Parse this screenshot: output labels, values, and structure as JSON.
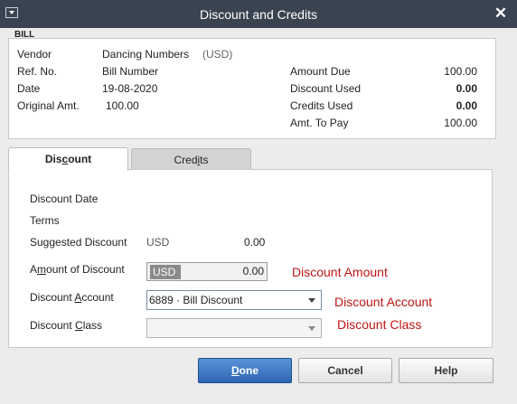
{
  "window": {
    "title": "Discount and Credits",
    "close_glyph": "✕"
  },
  "bill": {
    "section_label": "BILL",
    "vendor_label": "Vendor",
    "vendor_value": "Dancing Numbers",
    "vendor_currency": "(USD)",
    "refno_label": "Ref. No.",
    "refno_value": "Bill Number",
    "date_label": "Date",
    "date_value": "19-08-2020",
    "orig_label": "Original Amt.",
    "orig_value": "100.00",
    "amount_due_label": "Amount Due",
    "amount_due_value": "100.00",
    "discount_used_label": "Discount Used",
    "discount_used_value": "0.00",
    "credits_used_label": "Credits Used",
    "credits_used_value": "0.00",
    "amt_to_pay_label": "Amt. To Pay",
    "amt_to_pay_value": "100.00"
  },
  "tabs": {
    "discount": {
      "pre": "Dis",
      "key": "c",
      "post": "ount"
    },
    "credits": {
      "pre": "Cred",
      "key": "i",
      "post": "ts"
    }
  },
  "discount": {
    "date_label": "Discount Date",
    "terms_label": "Terms",
    "suggested_label": "Suggested Discount",
    "suggested_currency": "USD",
    "suggested_value": "0.00",
    "amount_label_pre": "A",
    "amount_label_key": "m",
    "amount_label_post": "ount of Discount",
    "amount_currency": "USD",
    "amount_value": "0.00",
    "amount_annotation": "Discount Amount",
    "account_label_pre": "Discount ",
    "account_label_key": "A",
    "account_label_post": "ccount",
    "account_value": "6889 · Bill Discount",
    "account_annotation": "Discount Account",
    "class_label_pre": "Discount ",
    "class_label_key": "C",
    "class_label_post": "lass",
    "class_value": "",
    "class_annotation": "Discount Class"
  },
  "buttons": {
    "done_key": "D",
    "done_rest": "one",
    "cancel": "Cancel",
    "help": "Help"
  },
  "colors": {
    "titlebar": "#3a4350",
    "annotation_red": "#c01515",
    "done_blue": "#2f66b3"
  }
}
